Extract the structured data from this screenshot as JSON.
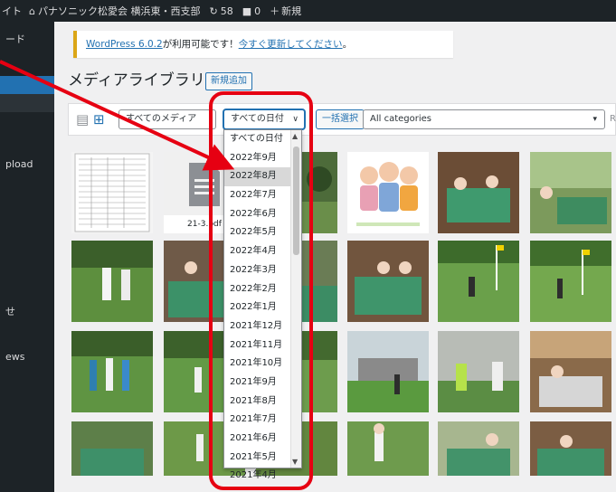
{
  "admin_bar": {
    "site_prefix": "イト",
    "site_name": "パナソニック松愛会 横浜東・西支部",
    "updates_count": "58",
    "comments_count": "0",
    "new_label": "新規"
  },
  "sidebar": {
    "items": [
      "ード",
      "",
      "",
      "pload",
      "せ",
      "ews"
    ]
  },
  "notice": {
    "version_link": "WordPress 6.0.2",
    "middle_text": "が利用可能です！",
    "update_link": "今すぐ更新してください",
    "end": "。"
  },
  "page": {
    "title": "メディアライブラリ",
    "add_new": "新規追加"
  },
  "toolbar": {
    "media_filter": "すべてのメディア",
    "date_filter": "すべての日付",
    "bulk_select": "一括選択",
    "category_filter": "All categories",
    "search_partial": "R"
  },
  "file_item": {
    "label": "21-3.pdf"
  },
  "date_dropdown": {
    "options": [
      "すべての日付",
      "2022年9月",
      "2022年8月",
      "2022年7月",
      "2022年6月",
      "2022年5月",
      "2022年4月",
      "2022年3月",
      "2022年2月",
      "2022年1月",
      "2021年12月",
      "2021年11月",
      "2021年10月",
      "2021年9月",
      "2021年8月",
      "2021年7月",
      "2021年6月",
      "2021年5月",
      "2021年4月"
    ],
    "highlighted": "2022年8月"
  },
  "colors": {
    "admin_bar": "#1d2327",
    "accent": "#2271b1",
    "annotation_red": "#e60012",
    "notice_border": "#dba617"
  }
}
